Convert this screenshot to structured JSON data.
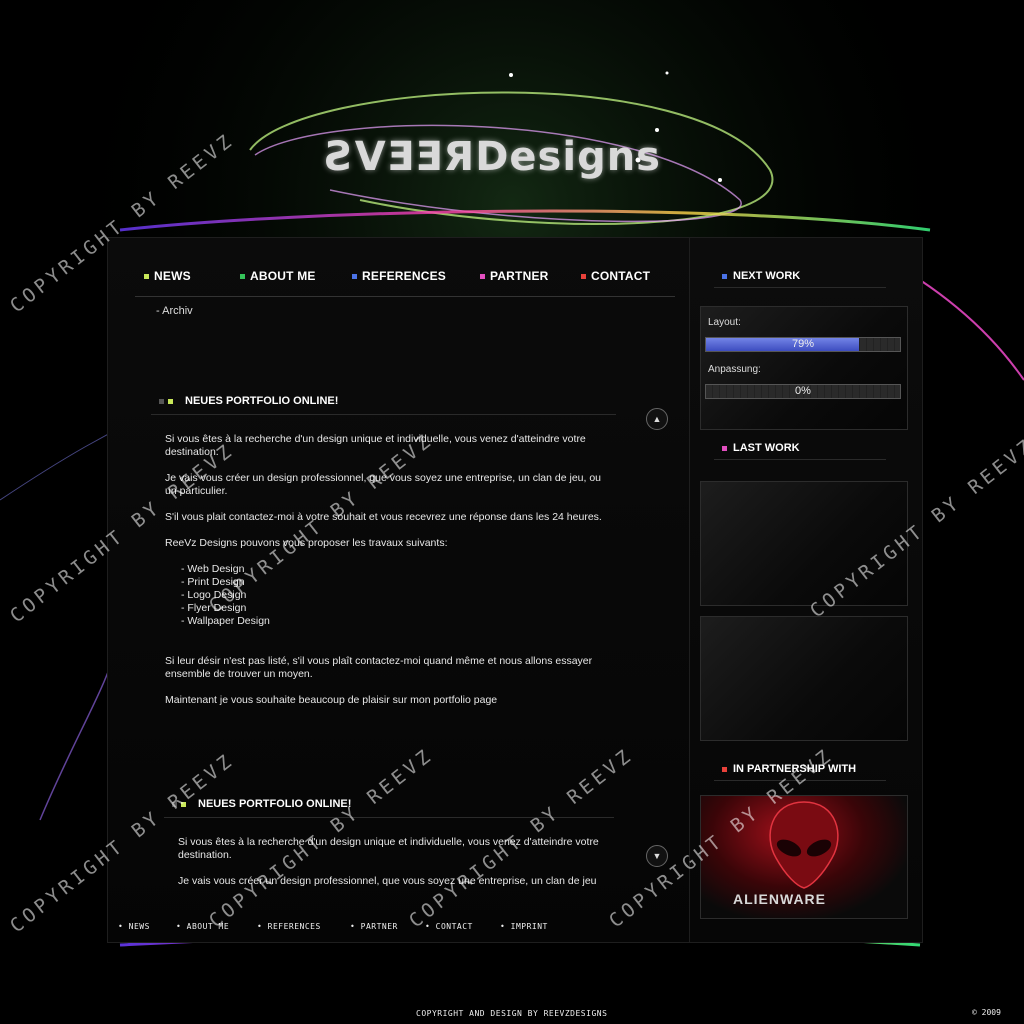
{
  "logo": {
    "text": "ƧVƎƎЯDesigns"
  },
  "nav": {
    "items": [
      {
        "label": "NEWS",
        "color": "#c9e85a"
      },
      {
        "label": "ABOUT ME",
        "color": "#35c45a"
      },
      {
        "label": "REFERENCES",
        "color": "#4b73e8"
      },
      {
        "label": "PARTNER",
        "color": "#e24fbf"
      },
      {
        "label": "CONTACT",
        "color": "#e8413a"
      }
    ],
    "sub": "- Archiv"
  },
  "posts": [
    {
      "title": "NEUES PORTFOLIO ONLINE!",
      "paragraphs": [
        "Si vous êtes à la recherche d'un design unique et individuelle, vous venez d'atteindre votre destination.",
        "Je vais vous créer un design professionnel, que vous soyez une entreprise, un clan de jeu, ou un particulier.",
        "S'il vous plait contactez-moi à votre souhait et vous recevrez une réponse dans les 24 heures.",
        "ReeVz Designs pouvons vous proposer les travaux suivants:"
      ],
      "list": [
        "- Web Design",
        "- Print Design",
        "- Logo Design",
        "- Flyer Design",
        "- Wallpaper Design"
      ],
      "closing": [
        "Si leur désir n'est pas listé, s'il vous plaît contactez-moi quand même et nous allons essayer ensemble de trouver un moyen.",
        "Maintenant je vous souhaite beaucoup de plaisir sur mon portfolio page"
      ]
    },
    {
      "title": "NEUES PORTFOLIO ONLINE!",
      "paragraphs": [
        "Si vous êtes à la recherche d'un design unique et individuelle, vous venez d'atteindre votre destination.",
        "Je vais vous créer un design professionnel, que vous soyez une entreprise, un clan de jeu"
      ]
    }
  ],
  "sidebar": {
    "next_work": {
      "title": "NEXT WORK",
      "color": "#4b73e8"
    },
    "layout": {
      "label": "Layout:",
      "percent_text": "79%",
      "value": 0.79
    },
    "anpassung": {
      "label": "Anpassung:",
      "percent_text": "0%",
      "value": 0
    },
    "last_work": {
      "title": "LAST WORK",
      "color": "#e24fbf"
    },
    "partnership": {
      "title": "IN PARTNERSHIP WITH",
      "color": "#e8413a",
      "partner": "ALIENWARE"
    }
  },
  "footer": {
    "links": [
      "• NEWS",
      "• ABOUT ME",
      "• REFERENCES",
      "• PARTNER",
      "• CONTACT",
      "• IMPRINT"
    ],
    "copyright": "COPYRIGHT AND DESIGN BY REEVZDESIGNS",
    "year": "© 2009"
  },
  "watermark": "COPYRIGHT BY REEVZ"
}
